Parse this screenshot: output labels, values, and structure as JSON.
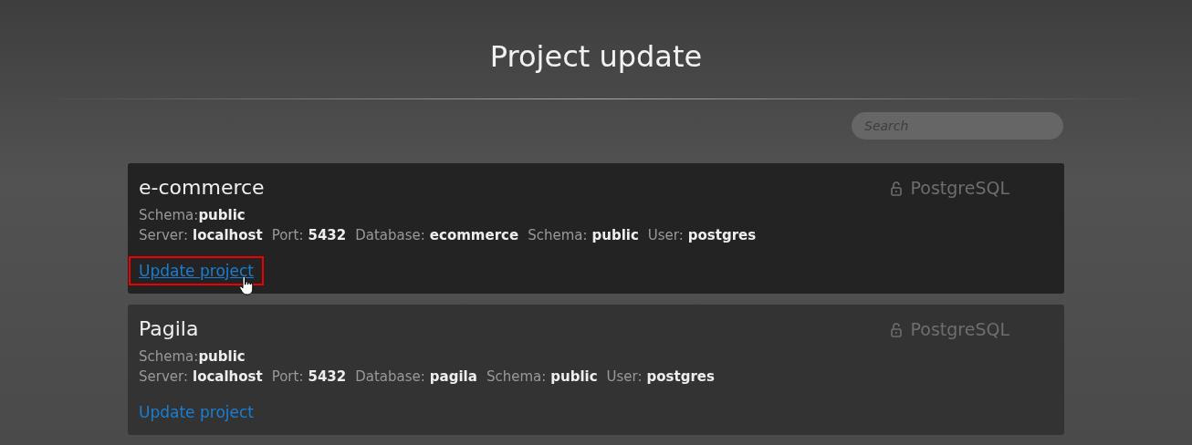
{
  "title": "Project update",
  "search": {
    "placeholder": "Search"
  },
  "projects": [
    {
      "name": "e-commerce",
      "db_type": "PostgreSQL",
      "schema_label": "Schema:",
      "schema_value": "public",
      "hovered": true,
      "link": "Update project",
      "link_focused": true,
      "details": [
        {
          "label": "Server:",
          "value": "localhost"
        },
        {
          "label": "Port:",
          "value": "5432"
        },
        {
          "label": "Database:",
          "value": "ecommerce"
        },
        {
          "label": "Schema:",
          "value": "public"
        },
        {
          "label": "User:",
          "value": "postgres"
        }
      ]
    },
    {
      "name": "Pagila",
      "db_type": "PostgreSQL",
      "schema_label": "Schema:",
      "schema_value": "public",
      "hovered": false,
      "link": "Update project",
      "link_focused": false,
      "details": [
        {
          "label": "Server:",
          "value": "localhost"
        },
        {
          "label": "Port:",
          "value": "5432"
        },
        {
          "label": "Database:",
          "value": "pagila"
        },
        {
          "label": "Schema:",
          "value": "public"
        },
        {
          "label": "User:",
          "value": "postgres"
        }
      ]
    }
  ]
}
